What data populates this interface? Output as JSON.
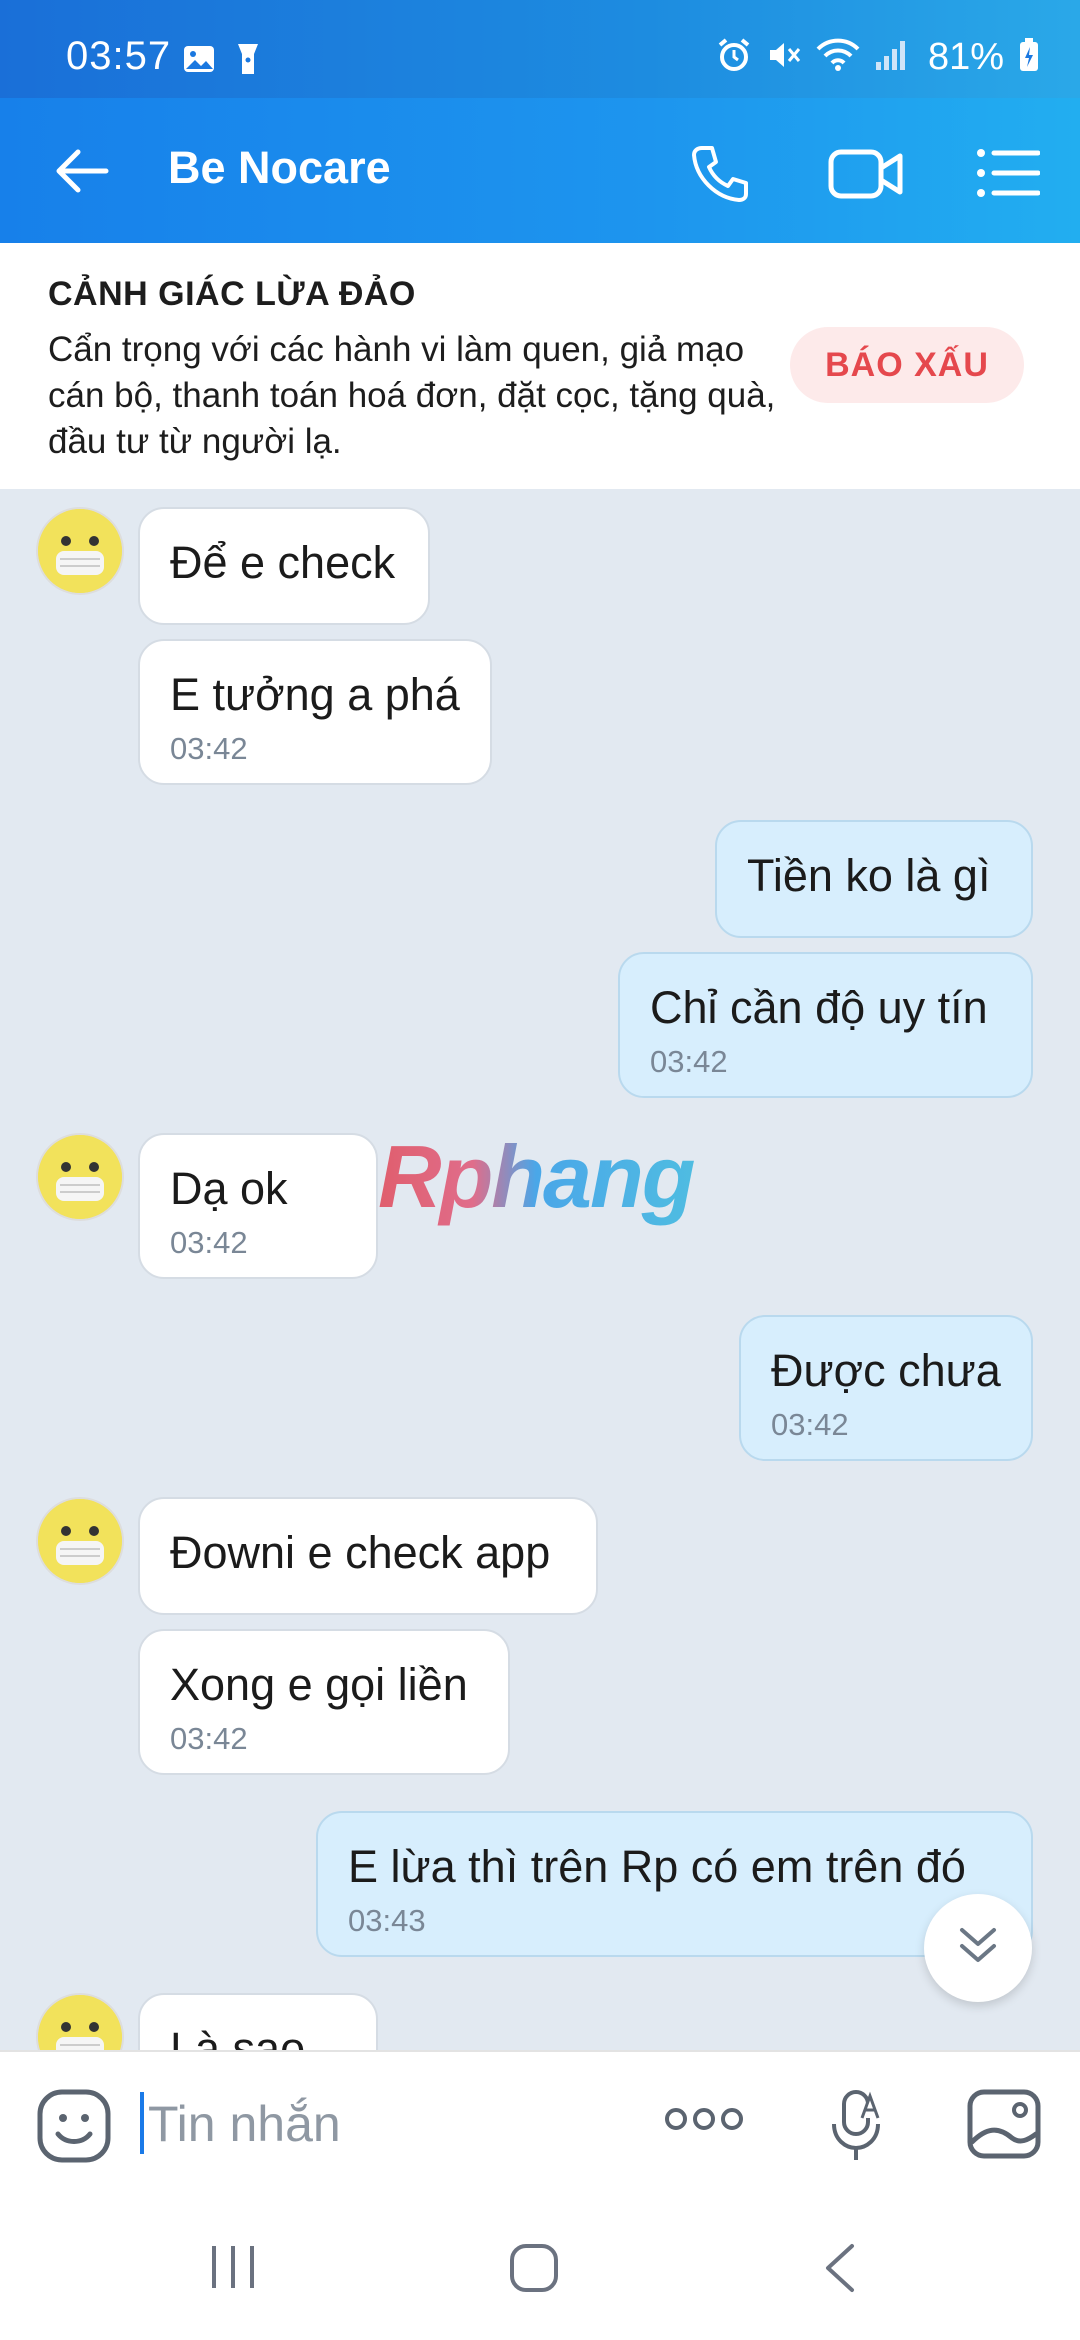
{
  "status_bar": {
    "time": "03:57",
    "battery": "81%"
  },
  "header": {
    "title": "Be Nocare"
  },
  "warning": {
    "title": "CẢNH GIÁC LỪA ĐẢO",
    "text": "Cẩn trọng với các hành vi làm quen, giả mạo cán bộ, thanh toán hoá đơn, đặt cọc, tặng quà, đầu tư từ người lạ.",
    "report_button": "BÁO XẤU"
  },
  "messages": [
    {
      "from": "them",
      "text": "Để e check",
      "time": ""
    },
    {
      "from": "them",
      "text": "E tưởng a phá",
      "time": "03:42"
    },
    {
      "from": "me",
      "text": "Tiền ko là gì",
      "time": ""
    },
    {
      "from": "me",
      "text": "Chỉ cần độ uy tín",
      "time": "03:42"
    },
    {
      "from": "them",
      "text": "Dạ ok",
      "time": "03:42"
    },
    {
      "from": "me",
      "text": "Được chưa",
      "time": "03:42"
    },
    {
      "from": "them",
      "text": "Đowni e check app",
      "time": ""
    },
    {
      "from": "them",
      "text": "Xong e gọi liền",
      "time": "03:42"
    },
    {
      "from": "me",
      "text": "E lừa thì trên Rp có em trên đó",
      "time": "03:43"
    },
    {
      "from": "them",
      "text": "Là sao",
      "time": ""
    }
  ],
  "watermark": "Rphang",
  "composer": {
    "placeholder": "Tin nhắn"
  },
  "colors": {
    "header_blue": "#1d95ee",
    "outgoing_bubble": "#d7eefd",
    "incoming_bubble": "#ffffff",
    "report_red": "#e5484d"
  }
}
